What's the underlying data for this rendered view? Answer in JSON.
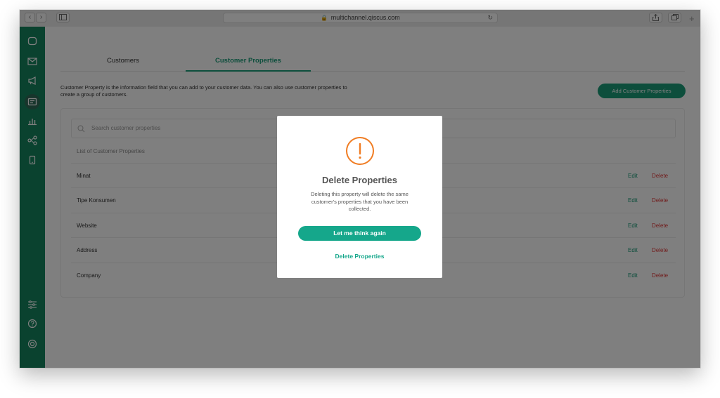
{
  "browser": {
    "url": "multichannel.qiscus.com",
    "back_icon": "chevron-left-icon",
    "forward_icon": "chevron-right-icon",
    "sidebar_toggle_icon": "sidebar-icon",
    "share_icon": "share-icon",
    "tabs_icon": "tabs-icon",
    "new_tab_icon": "plus-icon",
    "reload_icon": "reload-icon",
    "lock_icon": "lock-icon"
  },
  "sidebar": {
    "color": "#14845f",
    "top_items": [
      "chat-icon",
      "mail-icon",
      "megaphone-icon",
      "contact-card-icon",
      "analytics-icon",
      "integration-icon",
      "mobile-icon"
    ],
    "active_item": "contact-card-icon",
    "bottom_items": [
      "settings-sliders-icon",
      "help-icon",
      "profile-icon"
    ]
  },
  "tabs": [
    {
      "label": "Customers",
      "active": false
    },
    {
      "label": "Customer Properties",
      "active": true
    }
  ],
  "description": "Customer Property is the information field that you can add to your customer data. You can also use customer properties to create a group of customers.",
  "add_button": "Add Customer Properties",
  "search": {
    "placeholder": "Search customer properties"
  },
  "list_header": "List of Customer Properties",
  "properties": [
    {
      "name": "Minat",
      "edit": "Edit",
      "delete": "Delete"
    },
    {
      "name": "Tipe Konsumen",
      "edit": "Edit",
      "delete": "Delete"
    },
    {
      "name": "Website",
      "edit": "Edit",
      "delete": "Delete"
    },
    {
      "name": "Address",
      "edit": "Edit",
      "delete": "Delete"
    },
    {
      "name": "Company",
      "edit": "Edit",
      "delete": "Delete"
    }
  ],
  "modal": {
    "icon": "warning-icon",
    "title": "Delete Properties",
    "message": "Deleting this property will delete the same customer's properties that you have been collected.",
    "primary_button": "Let me think again",
    "secondary_button": "Delete Properties"
  },
  "colors": {
    "accent": "#1b9c79",
    "delete": "#e23a3a",
    "warning": "#f07c22"
  }
}
